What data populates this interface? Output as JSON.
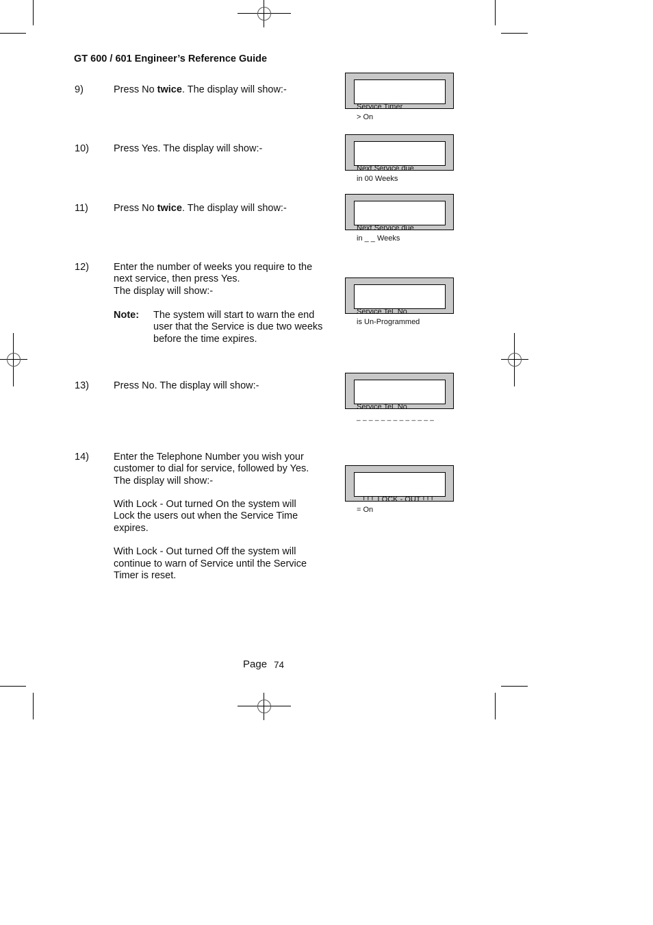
{
  "header": {
    "title": "GT 600 / 601 Engineer’s Reference Guide"
  },
  "steps": [
    {
      "number": "9)",
      "pre": "Press No ",
      "bold": "twice",
      "post": ". The display will show:-",
      "display": [
        "Service Timer",
        "> On"
      ]
    },
    {
      "number": "10)",
      "text": "Press Yes. The display will show:-",
      "display": [
        "Next Service due",
        "in 00 Weeks"
      ]
    },
    {
      "number": "11)",
      "pre": "Press No ",
      "bold": "twice",
      "post": ". The display will show:-",
      "display": [
        "Next Service due",
        "in _ _ Weeks"
      ]
    },
    {
      "number": "12)",
      "lines": [
        "Enter the number of weeks you require to the",
        "next service, then press Yes.",
        "The display will show:-"
      ],
      "note_label": "Note:",
      "note_lines": [
        "The system will start to warn the end",
        "user that the Service is due two weeks",
        "before the time expires."
      ],
      "display": [
        "Service Tel. No.",
        "is Un-Programmed"
      ]
    },
    {
      "number": "13)",
      "text": "Press No. The display will show:-",
      "display": [
        "Service Tel. No.",
        "_ _ _ _ _ _ _ _ _ _ _ _ _"
      ]
    },
    {
      "number": "14)",
      "lines": [
        "Enter the Telephone Number you wish your",
        "customer to dial for service, followed by Yes.",
        "The display will show:-"
      ],
      "para1": [
        "With Lock - Out turned On the system will",
        "Lock the users out when the Service Time",
        "expires."
      ],
      "para2": [
        "With Lock - Out turned Off the system will",
        "continue to warn of Service until the Service",
        "Timer is reset."
      ],
      "display": [
        "   ! ! !  LOCK - OUT ! ! !",
        "= On"
      ]
    }
  ],
  "footer": {
    "page_label": "Page",
    "page_number": "74"
  },
  "colors": {
    "lcd_frame": "#c8c8c8",
    "lcd_screen": "#ffffff",
    "text": "#111111"
  }
}
